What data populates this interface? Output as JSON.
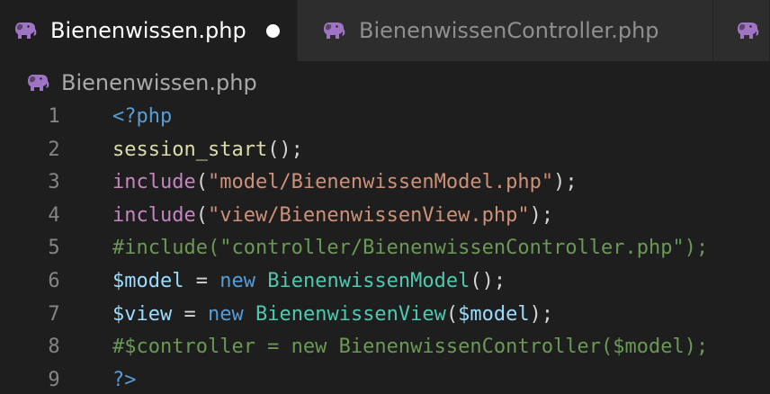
{
  "tabs": [
    {
      "label": "Bienenwissen.php",
      "active": true,
      "dirty": true,
      "icon": "elephant-icon"
    },
    {
      "label": "BienenwissenController.php",
      "active": false,
      "dirty": false,
      "icon": "elephant-icon"
    },
    {
      "label": "",
      "active": false,
      "dirty": false,
      "icon": "elephant-icon"
    }
  ],
  "breadcrumb": {
    "label": "Bienenwissen.php",
    "icon": "elephant-icon"
  },
  "colors": {
    "php_icon": "#a074c4",
    "editor_bg": "#1e1e1e",
    "tab_bar_bg": "#252526",
    "inactive_tab_bg": "#2d2d2d"
  },
  "code": {
    "lines": [
      {
        "number": "1",
        "tokens": [
          {
            "t": "<?php",
            "c": "tag"
          }
        ]
      },
      {
        "number": "2",
        "tokens": [
          {
            "t": "session_start",
            "c": "fn"
          },
          {
            "t": "();",
            "c": "punc"
          }
        ]
      },
      {
        "number": "3",
        "tokens": [
          {
            "t": "include",
            "c": "kw"
          },
          {
            "t": "(",
            "c": "punc"
          },
          {
            "t": "\"model/BienenwissenModel.php\"",
            "c": "str"
          },
          {
            "t": ");",
            "c": "punc"
          }
        ]
      },
      {
        "number": "4",
        "tokens": [
          {
            "t": "include",
            "c": "kw"
          },
          {
            "t": "(",
            "c": "punc"
          },
          {
            "t": "\"view/BienenwissenView.php\"",
            "c": "str"
          },
          {
            "t": ");",
            "c": "punc"
          }
        ]
      },
      {
        "number": "5",
        "tokens": [
          {
            "t": "#include(\"controller/BienenwissenController.php\");",
            "c": "comment"
          }
        ]
      },
      {
        "number": "6",
        "tokens": [
          {
            "t": "$model",
            "c": "var"
          },
          {
            "t": " = ",
            "c": "punc"
          },
          {
            "t": "new",
            "c": "new"
          },
          {
            "t": " ",
            "c": "punc"
          },
          {
            "t": "BienenwissenModel",
            "c": "class"
          },
          {
            "t": "();",
            "c": "punc"
          }
        ]
      },
      {
        "number": "7",
        "tokens": [
          {
            "t": "$view",
            "c": "var"
          },
          {
            "t": " = ",
            "c": "punc"
          },
          {
            "t": "new",
            "c": "new"
          },
          {
            "t": " ",
            "c": "punc"
          },
          {
            "t": "BienenwissenView",
            "c": "class"
          },
          {
            "t": "(",
            "c": "punc"
          },
          {
            "t": "$model",
            "c": "var"
          },
          {
            "t": ");",
            "c": "punc"
          }
        ]
      },
      {
        "number": "8",
        "tokens": [
          {
            "t": "#$controller = new BienenwissenController($model);",
            "c": "comment"
          }
        ]
      },
      {
        "number": "9",
        "tokens": [
          {
            "t": "?>",
            "c": "tag"
          }
        ]
      }
    ]
  }
}
